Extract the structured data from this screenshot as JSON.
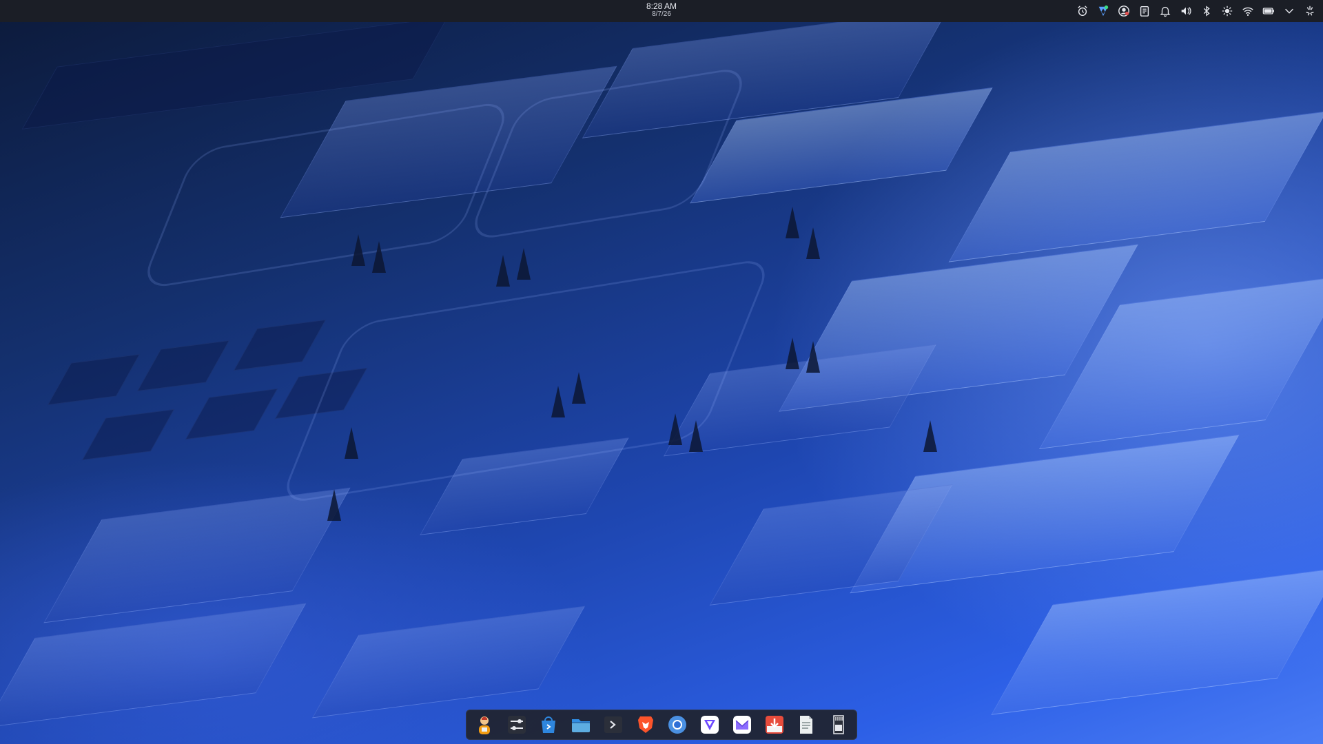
{
  "top_panel": {
    "clock": {
      "time": "8:28 AM",
      "date": "8/7/26"
    },
    "tray_icons": [
      "alarm-icon",
      "vpn-shield-icon",
      "user-sync-icon",
      "clipboard-icon",
      "notifications-icon",
      "volume-icon",
      "bluetooth-icon",
      "brightness-icon",
      "wifi-icon",
      "battery-icon",
      "expand-tray-chevron-icon",
      "system-menu-icon"
    ]
  },
  "dock": {
    "apps": [
      "user-avatar-app-icon",
      "settings-sliders-app-icon",
      "software-store-app-icon",
      "file-manager-app-icon",
      "terminal-app-icon",
      "brave-browser-app-icon",
      "chromium-browser-app-icon",
      "vpn-app-icon",
      "mail-app-icon",
      "download-manager-app-icon",
      "text-editor-app-icon",
      "storage-card-app-icon"
    ]
  },
  "colors": {
    "panel": "#1b1e26",
    "dock": "#20232d",
    "wallpaper_accent": "#2c5fe6"
  }
}
